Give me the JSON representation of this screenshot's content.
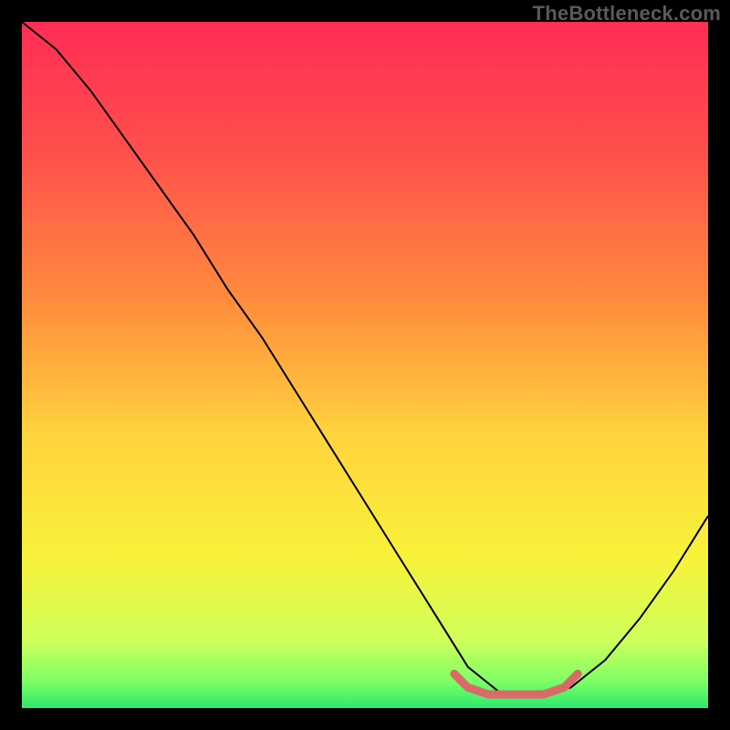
{
  "watermark": "TheBottleneck.com",
  "chart_data": {
    "type": "line",
    "title": "",
    "xlabel": "",
    "ylabel": "",
    "xlim": [
      0,
      100
    ],
    "ylim": [
      0,
      100
    ],
    "x": [
      0,
      5,
      10,
      15,
      20,
      25,
      30,
      35,
      40,
      45,
      50,
      55,
      60,
      65,
      70,
      75,
      80,
      85,
      90,
      95,
      100
    ],
    "series": [
      {
        "name": "curve",
        "color": "#000000",
        "values": [
          100,
          96,
          90,
          83,
          76,
          69,
          61,
          54,
          46,
          38,
          30,
          22,
          14,
          6,
          2,
          2,
          3,
          7,
          13,
          20,
          28
        ]
      }
    ],
    "highlight": {
      "name": "optimal-segment",
      "color": "#d86a6a",
      "x": [
        63,
        65,
        68,
        72,
        76,
        79,
        81
      ],
      "values": [
        5,
        3,
        2,
        2,
        2,
        3,
        5
      ]
    },
    "gradient_stops": [
      {
        "pos": 0.0,
        "color": "#ff2d55"
      },
      {
        "pos": 0.18,
        "color": "#ff4d4d"
      },
      {
        "pos": 0.4,
        "color": "#ff8a3d"
      },
      {
        "pos": 0.6,
        "color": "#ffd33d"
      },
      {
        "pos": 0.78,
        "color": "#f8f23a"
      },
      {
        "pos": 0.9,
        "color": "#cfff5a"
      },
      {
        "pos": 0.96,
        "color": "#7fff66"
      },
      {
        "pos": 1.0,
        "color": "#2ee86b"
      }
    ]
  }
}
